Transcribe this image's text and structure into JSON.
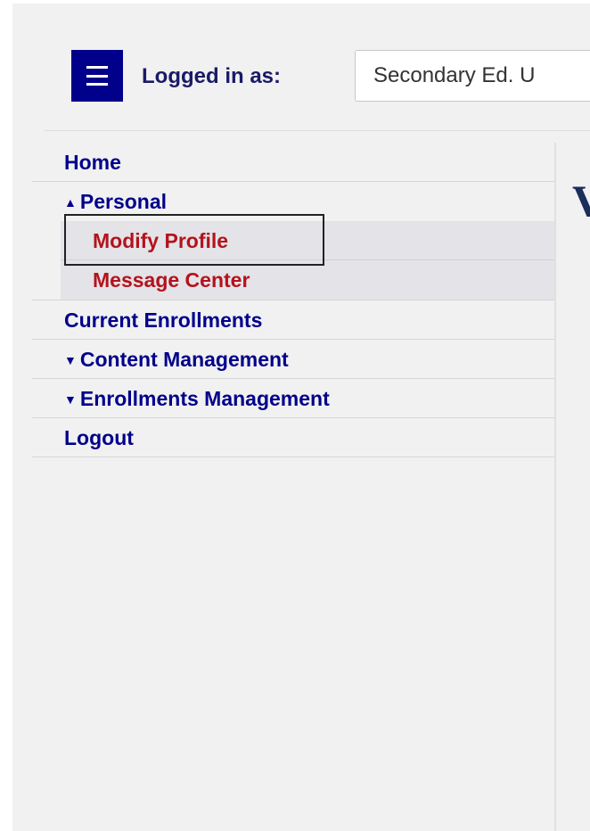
{
  "header": {
    "menu_icon": "hamburger-menu-icon",
    "logged_in_label": "Logged in as:",
    "role_value": "Secondary Ed. U"
  },
  "sidebar": {
    "items": [
      {
        "label": "Home",
        "caret": ""
      },
      {
        "label": "Personal",
        "caret": "▲"
      },
      {
        "label": "Current Enrollments",
        "caret": ""
      },
      {
        "label": "Content Management",
        "caret": "▼"
      },
      {
        "label": "Enrollments Management",
        "caret": "▼"
      },
      {
        "label": "Logout",
        "caret": ""
      }
    ],
    "personal_sub": [
      {
        "label": "Modify Profile"
      },
      {
        "label": "Message Center"
      }
    ]
  },
  "content": {
    "heading_fragment": "V"
  },
  "colors": {
    "nav_text": "#00008b",
    "sub_text": "#b5121b",
    "menu_button": "#00008b"
  }
}
